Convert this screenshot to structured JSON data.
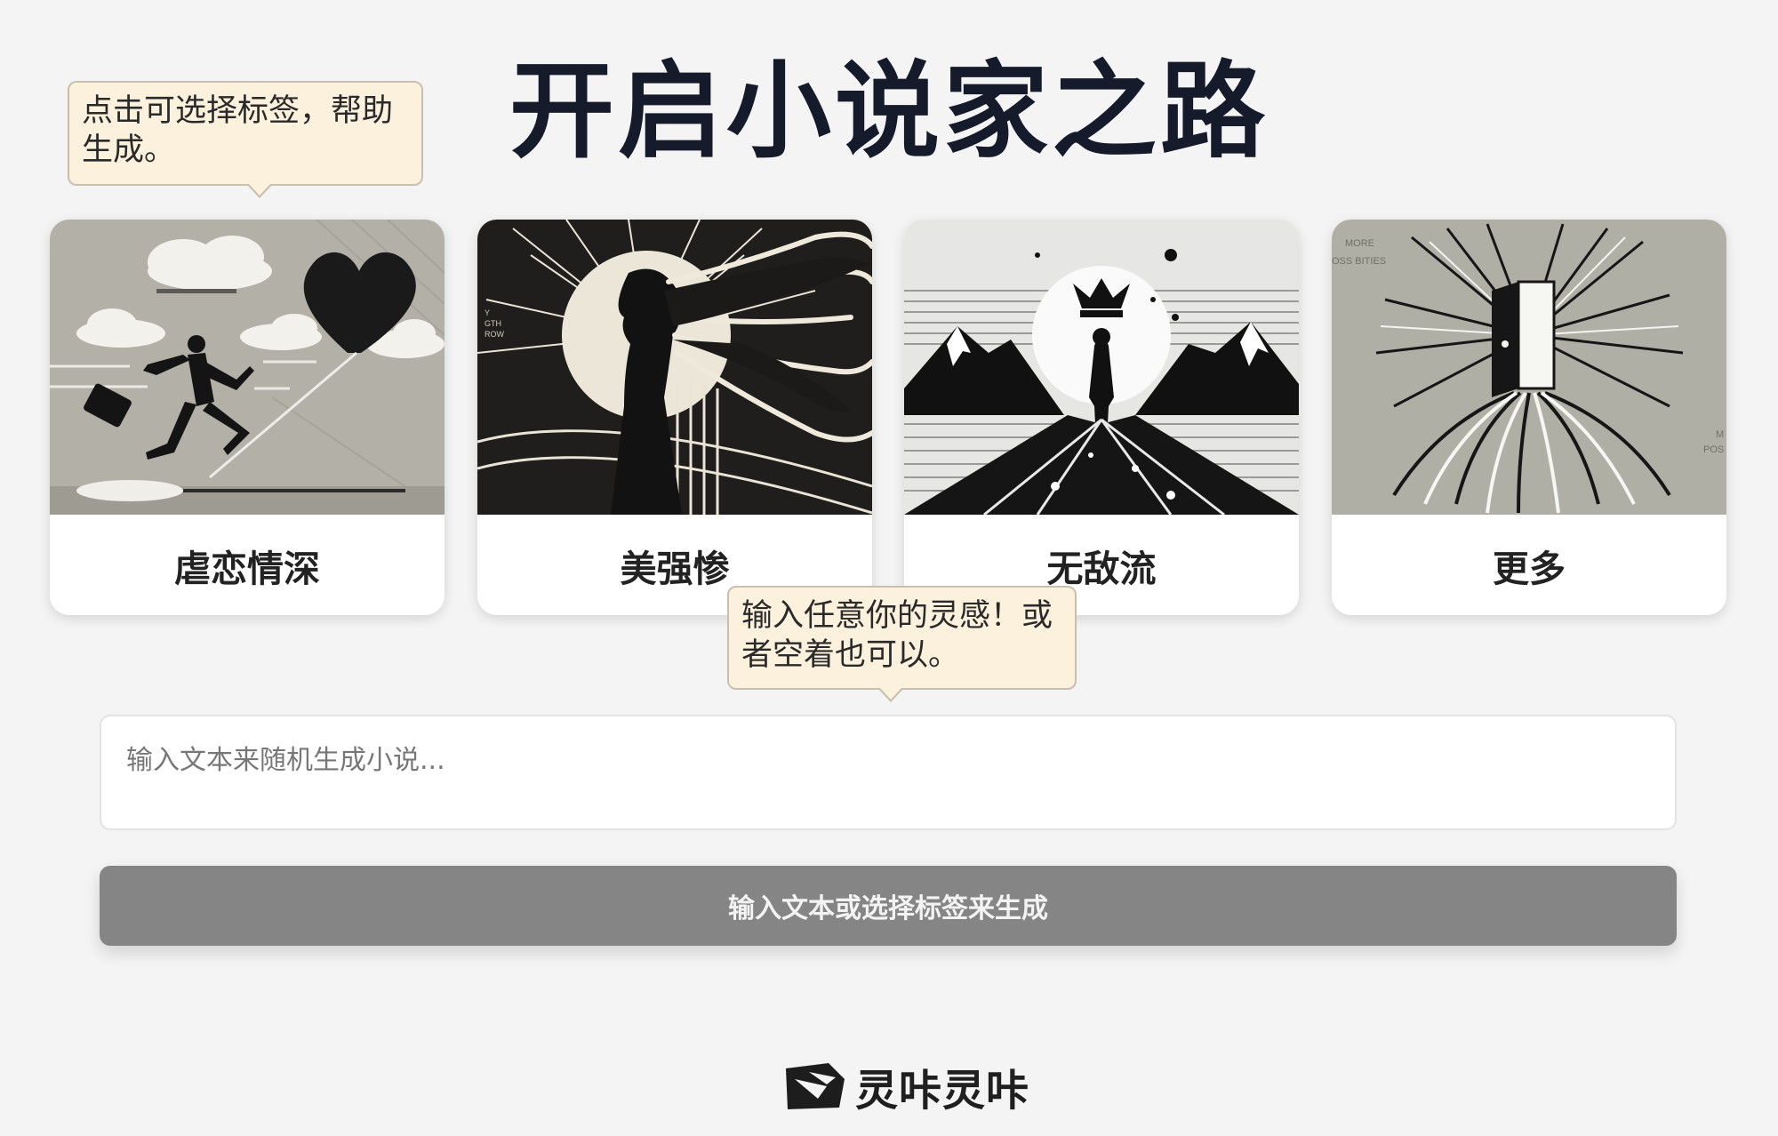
{
  "header": {
    "title": "开启小说家之路"
  },
  "tooltips": {
    "tags": "点击可选择标签，帮助生成。",
    "input": "输入任意你的灵感！或者空着也可以。"
  },
  "cards": [
    {
      "label": "虐恋情深",
      "icon": "running-man-heart-illustration"
    },
    {
      "label": "美强惨",
      "icon": "silhouette-woman-sun-illustration"
    },
    {
      "label": "无敌流",
      "icon": "crowned-figure-mountains-illustration"
    },
    {
      "label": "更多",
      "icon": "open-door-rays-illustration",
      "image_text": [
        "MORE",
        "OSS BITIES",
        "M",
        "POS"
      ]
    }
  ],
  "card2_image_text": [
    "Y",
    "GTH",
    "ROW"
  ],
  "prompt": {
    "placeholder": "输入文本来随机生成小说..."
  },
  "generate": {
    "label": "输入文本或选择标签来生成"
  },
  "footer": {
    "brand": "灵咔灵咔"
  },
  "colors": {
    "background": "#f4f4f4",
    "tooltip": "#fbf1dd",
    "button": "#858585",
    "title": "#151b2b"
  }
}
